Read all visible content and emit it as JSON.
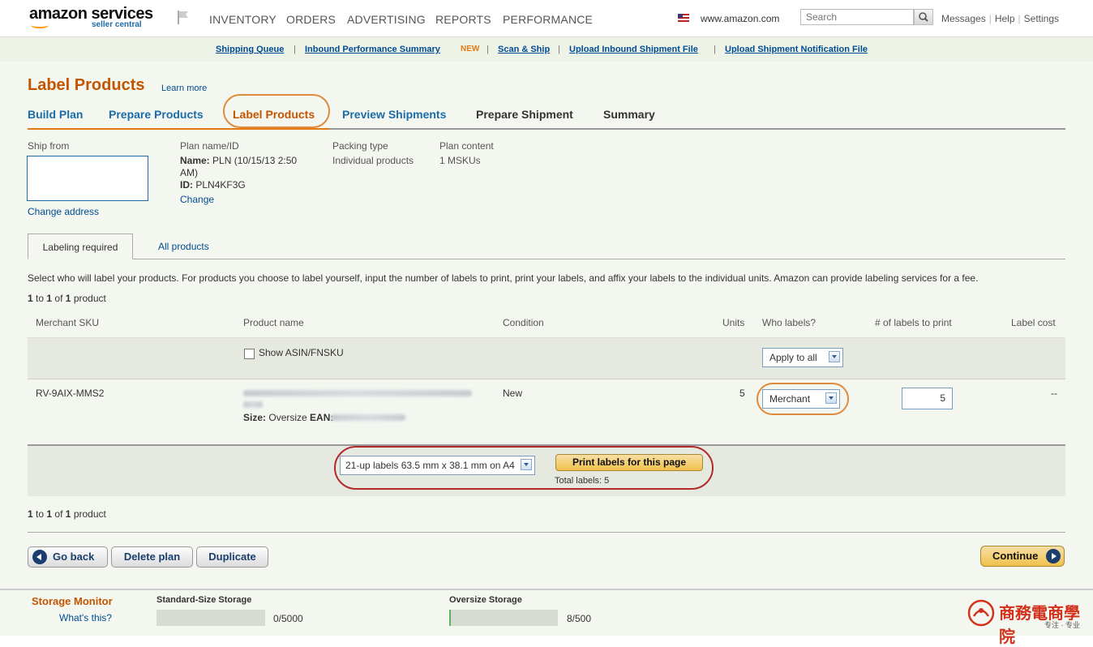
{
  "header": {
    "logo_main": "amazon services",
    "logo_sub": "seller central",
    "nav": [
      "INVENTORY",
      "ORDERS",
      "ADVERTISING",
      "REPORTS",
      "PERFORMANCE"
    ],
    "site": "www.amazon.com",
    "search_placeholder": "Search",
    "links": [
      "Messages",
      "Help",
      "Settings"
    ]
  },
  "subnav": {
    "links": [
      "Shipping Queue",
      "Inbound Performance Summary",
      "Scan & Ship",
      "Upload Inbound Shipment File",
      "Upload Shipment Notification File"
    ],
    "new_badge": "NEW",
    "separator": "|"
  },
  "page": {
    "title": "Label Products",
    "learn_more": "Learn more",
    "steps": [
      "Build Plan",
      "Prepare Products",
      "Label Products",
      "Preview Shipments",
      "Prepare Shipment",
      "Summary"
    ]
  },
  "plan_info": {
    "ship_from_label": "Ship from",
    "change_address": "Change address",
    "plan_label": "Plan name/ID",
    "name_label": "Name:",
    "name_value": "PLN (10/15/13 2:50",
    "name_value_cont": "AM)",
    "id_label": "ID:",
    "id_value": "PLN4KF3G",
    "change": "Change",
    "packing_label": "Packing type",
    "packing_value": "Individual products",
    "content_label": "Plan content",
    "content_value": "1 MSKUs"
  },
  "tabs": {
    "active": "Labeling required",
    "other": "All products"
  },
  "description": "Select who will label your products. For products you choose to label yourself, input the number of labels to print, print your labels, and affix your labels to the individual units. Amazon can provide labeling services for a fee.",
  "pagination": {
    "one": "1",
    "to": "to",
    "of": "of",
    "product": "product"
  },
  "table": {
    "headers": [
      "Merchant SKU",
      "Product name",
      "Condition",
      "Units",
      "Who labels?",
      "# of labels to print",
      "Label cost"
    ],
    "show_asin": "Show ASIN/FNSKU",
    "apply_all": "Apply to all",
    "row": {
      "sku": "RV-9AIX-MMS2",
      "size_label": "Size:",
      "size_value": "Oversize",
      "ean_label": "EAN:",
      "condition": "New",
      "units": "5",
      "who_labels": "Merchant",
      "labels_to_print": "5",
      "label_cost": "--"
    }
  },
  "print": {
    "label_format": "21-up labels 63.5 mm x 38.1 mm on A4",
    "button": "Print labels for this page",
    "total": "Total labels: 5"
  },
  "actions": {
    "go_back": "Go back",
    "delete_plan": "Delete plan",
    "duplicate": "Duplicate",
    "continue": "Continue"
  },
  "footer": {
    "storage_monitor": "Storage Monitor",
    "whats_this": "What's this?",
    "standard_label": "Standard-Size Storage",
    "standard_value": "0/5000",
    "standard_fraction": 0,
    "oversize_label": "Oversize Storage",
    "oversize_value": "8/500",
    "oversize_fraction": 0.016
  },
  "watermark": {
    "text": "商務電商學院",
    "sub": "专注 · 专业"
  },
  "colors": {
    "accent_orange": "#c45500",
    "link_blue": "#004b91",
    "highlight_ring_orange": "#e08a3c",
    "highlight_ring_red": "#b02a2a"
  }
}
